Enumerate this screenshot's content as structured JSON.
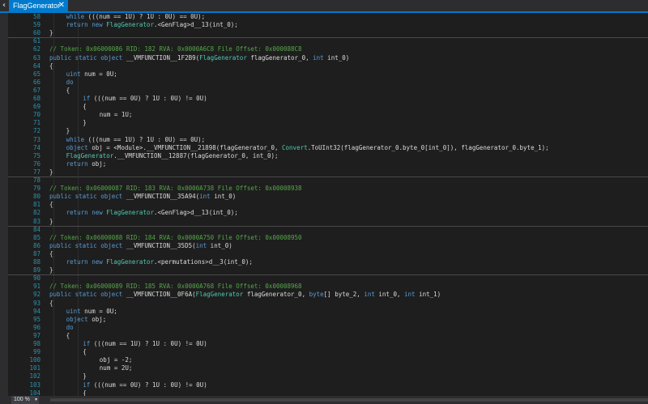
{
  "tab": {
    "title": "FlagGenerator",
    "close_glyph": "✕"
  },
  "scroll_left_glyph": "‹",
  "zoom": {
    "value": "100 %",
    "arrow": "▾"
  },
  "lines": [
    {
      "n": "58",
      "t": "while (((num == 1U) ? 1U : 0U) == 0U);",
      "i": 3
    },
    {
      "n": "59",
      "t": "return new FlagGenerator.<GenFlag>d__13(int_0);",
      "i": 3
    },
    {
      "n": "60",
      "t": "}",
      "i": 2,
      "sep": true
    },
    {
      "n": "61",
      "t": "",
      "i": 0
    },
    {
      "n": "62",
      "t": "// Token: 0x06000086 RID: 182 RVA: 0x0000A6C8 File Offset: 0x000088C8",
      "i": 2,
      "c": true
    },
    {
      "n": "63",
      "t": "public static object __VMFUNCTION__1F2B9(FlagGenerator flagGenerator_0, int int_0)",
      "i": 2
    },
    {
      "n": "64",
      "t": "{",
      "i": 2
    },
    {
      "n": "65",
      "t": "uint num = 0U;",
      "i": 3
    },
    {
      "n": "66",
      "t": "do",
      "i": 3
    },
    {
      "n": "67",
      "t": "{",
      "i": 3
    },
    {
      "n": "68",
      "t": "if (((num == 0U) ? 1U : 0U) != 0U)",
      "i": 4
    },
    {
      "n": "69",
      "t": "{",
      "i": 4
    },
    {
      "n": "70",
      "t": "num = 1U;",
      "i": 5
    },
    {
      "n": "71",
      "t": "}",
      "i": 4
    },
    {
      "n": "72",
      "t": "}",
      "i": 3
    },
    {
      "n": "73",
      "t": "while (((num == 1U) ? 1U : 0U) == 0U);",
      "i": 3
    },
    {
      "n": "74",
      "t": "object obj = <Module>.__VMFUNCTION__21898(flagGenerator_0, Convert.ToUInt32(flagGenerator_0.byte_0[int_0]), flagGenerator_0.byte_1);",
      "i": 3
    },
    {
      "n": "75",
      "t": "FlagGenerator.__VMFUNCTION__12887(flagGenerator_0, int_0);",
      "i": 3
    },
    {
      "n": "76",
      "t": "return obj;",
      "i": 3
    },
    {
      "n": "77",
      "t": "}",
      "i": 2,
      "sep": true
    },
    {
      "n": "78",
      "t": "",
      "i": 0
    },
    {
      "n": "79",
      "t": "// Token: 0x06000087 RID: 183 RVA: 0x0000A738 File Offset: 0x00008938",
      "i": 2,
      "c": true
    },
    {
      "n": "80",
      "t": "public static object __VMFUNCTION__35A94(int int_0)",
      "i": 2
    },
    {
      "n": "81",
      "t": "{",
      "i": 2
    },
    {
      "n": "82",
      "t": "return new FlagGenerator.<GenFlag>d__13(int_0);",
      "i": 3
    },
    {
      "n": "83",
      "t": "}",
      "i": 2,
      "sep": true
    },
    {
      "n": "84",
      "t": "",
      "i": 0
    },
    {
      "n": "85",
      "t": "// Token: 0x06000088 RID: 184 RVA: 0x0000A750 File Offset: 0x00008950",
      "i": 2,
      "c": true
    },
    {
      "n": "86",
      "t": "public static object __VMFUNCTION__35D5(int int_0)",
      "i": 2
    },
    {
      "n": "87",
      "t": "{",
      "i": 2
    },
    {
      "n": "88",
      "t": "return new FlagGenerator.<permutations>d__3(int_0);",
      "i": 3
    },
    {
      "n": "89",
      "t": "}",
      "i": 2,
      "sep": true
    },
    {
      "n": "90",
      "t": "",
      "i": 0
    },
    {
      "n": "91",
      "t": "// Token: 0x06000089 RID: 185 RVA: 0x0000A768 File Offset: 0x00008968",
      "i": 2,
      "c": true
    },
    {
      "n": "92",
      "t": "public static object __VMFUNCTION__0F6A(FlagGenerator flagGenerator_0, byte[] byte_2, int int_0, int int_1)",
      "i": 2
    },
    {
      "n": "93",
      "t": "{",
      "i": 2
    },
    {
      "n": "94",
      "t": "uint num = 0U;",
      "i": 3
    },
    {
      "n": "95",
      "t": "object obj;",
      "i": 3
    },
    {
      "n": "96",
      "t": "do",
      "i": 3
    },
    {
      "n": "97",
      "t": "{",
      "i": 3
    },
    {
      "n": "98",
      "t": "if (((num == 1U) ? 1U : 0U) != 0U)",
      "i": 4
    },
    {
      "n": "99",
      "t": "{",
      "i": 4
    },
    {
      "n": "100",
      "t": "obj = -2;",
      "i": 5
    },
    {
      "n": "101",
      "t": "num = 2U;",
      "i": 5
    },
    {
      "n": "102",
      "t": "}",
      "i": 4
    },
    {
      "n": "103",
      "t": "if (((num == 0U) ? 1U : 0U) != 0U)",
      "i": 4
    },
    {
      "n": "104",
      "t": "{",
      "i": 4
    }
  ],
  "colors": {
    "accent": "#007acc",
    "keyword": "#569cd6",
    "comment": "#57a64a",
    "type": "#4ec9b0",
    "number": "#b5cea8",
    "line_number": "#2b91af"
  }
}
